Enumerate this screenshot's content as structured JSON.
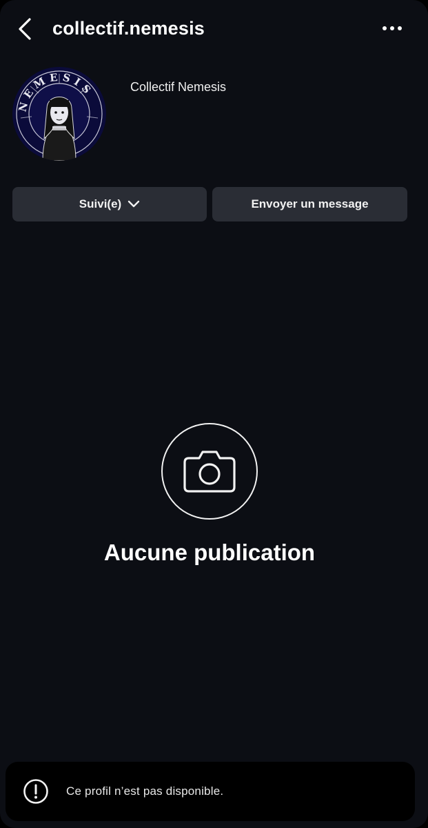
{
  "header": {
    "username": "collectif.nemesis",
    "back_icon": "chevron-left-icon",
    "more_icon": "more-horizontal-icon"
  },
  "profile": {
    "display_name": "Collectif Nemesis",
    "avatar_icon": "nemesis-logo-avatar",
    "avatar_text": "NEMESIS"
  },
  "actions": {
    "follow_label": "Suivi(e)",
    "follow_icon": "chevron-down-icon",
    "message_label": "Envoyer un message"
  },
  "empty_state": {
    "icon": "camera-icon",
    "title": "Aucune publication"
  },
  "toast": {
    "icon": "alert-circle-icon",
    "message": "Ce profil n’est pas disponible."
  },
  "colors": {
    "background": "#0c0e14",
    "button": "#2a2d35",
    "text": "#ffffff",
    "avatar_bg": "#0b0b3a"
  }
}
